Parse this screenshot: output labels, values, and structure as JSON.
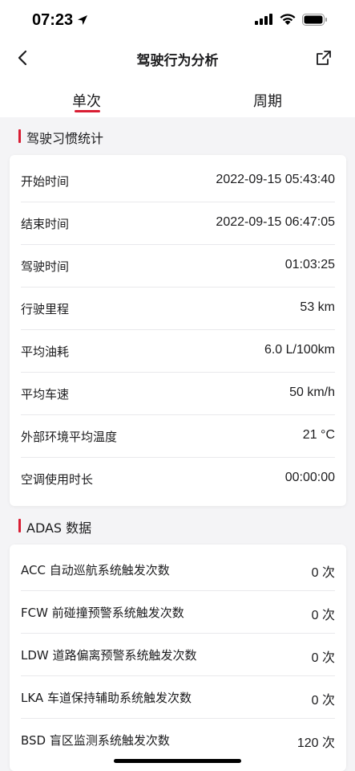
{
  "status": {
    "time": "07:23"
  },
  "nav": {
    "title": "驾驶行为分析"
  },
  "tabs": [
    {
      "label": "单次",
      "active": true
    },
    {
      "label": "周期",
      "active": false
    }
  ],
  "habits": {
    "title": "驾驶习惯统计",
    "rows": [
      {
        "label": "开始时间",
        "value": "2022-09-15 05:43:40"
      },
      {
        "label": "结束时间",
        "value": "2022-09-15 06:47:05"
      },
      {
        "label": "驾驶时间",
        "value": "01:03:25"
      },
      {
        "label": "行驶里程",
        "value": "53 km"
      },
      {
        "label": "平均油耗",
        "value": "6.0 L/100km"
      },
      {
        "label": "平均车速",
        "value": "50 km/h"
      },
      {
        "label": "外部环境平均温度",
        "value": "21 °C"
      },
      {
        "label": "空调使用时长",
        "value": "00:00:00"
      }
    ]
  },
  "adas": {
    "title": "ADAS 数据",
    "rows": [
      {
        "label": "ACC 自动巡航系统触发次数",
        "value": "0 次"
      },
      {
        "label": "FCW 前碰撞预警系统触发次数",
        "value": "0 次"
      },
      {
        "label": "LDW 道路偏离预警系统触发次数",
        "value": "0 次"
      },
      {
        "label": "LKA 车道保持辅助系统触发次数",
        "value": "0 次"
      },
      {
        "label": "BSD 盲区监测系统触发次数",
        "value": "120 次"
      }
    ]
  },
  "colors": {
    "accent": "#d91e34",
    "background": "#f4f4f6",
    "card": "#ffffff"
  }
}
